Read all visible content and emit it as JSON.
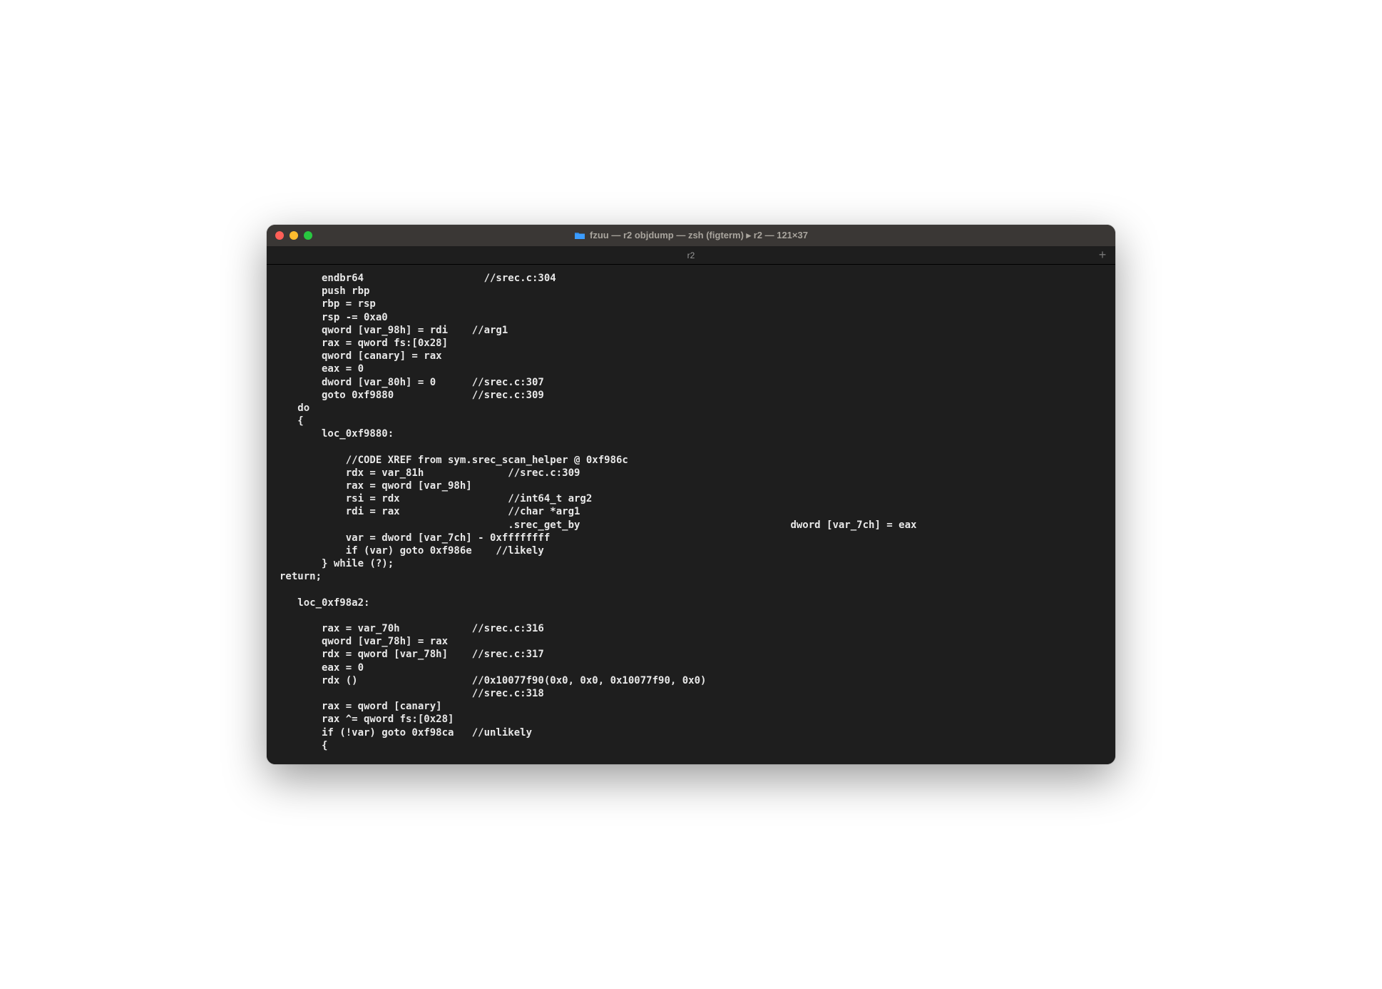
{
  "window": {
    "title": "fzuu — r2 objdump — zsh (figterm) ▸ r2 — 121×37"
  },
  "tab": {
    "title": "r2",
    "add_label": "+"
  },
  "terminal": {
    "lines": [
      "       endbr64                    //srec.c:304",
      "       push rbp",
      "       rbp = rsp",
      "       rsp -= 0xa0",
      "       qword [var_98h] = rdi    //arg1",
      "       rax = qword fs:[0x28]",
      "       qword [canary] = rax",
      "       eax = 0",
      "       dword [var_80h] = 0      //srec.c:307",
      "       goto 0xf9880             //srec.c:309",
      "   do",
      "   {",
      "       loc_0xf9880:",
      "",
      "           //CODE XREF from sym.srec_scan_helper @ 0xf986c",
      "           rdx = var_81h              //srec.c:309",
      "           rax = qword [var_98h]",
      "           rsi = rdx                  //int64_t arg2",
      "           rdi = rax                  //char *arg1",
      "                                      .srec_get_by                                   dword [var_7ch] = eax",
      "           var = dword [var_7ch] - 0xffffffff",
      "           if (var) goto 0xf986e    //likely",
      "       } while (?);",
      "return;",
      "",
      "   loc_0xf98a2:",
      "",
      "       rax = var_70h            //srec.c:316",
      "       qword [var_78h] = rax",
      "       rdx = qword [var_78h]    //srec.c:317",
      "       eax = 0",
      "       rdx ()                   //0x10077f90(0x0, 0x0, 0x10077f90, 0x0)",
      "                                //srec.c:318",
      "       rax = qword [canary]",
      "       rax ^= qword fs:[0x28]",
      "       if (!var) goto 0xf98ca   //unlikely",
      "       {"
    ]
  }
}
